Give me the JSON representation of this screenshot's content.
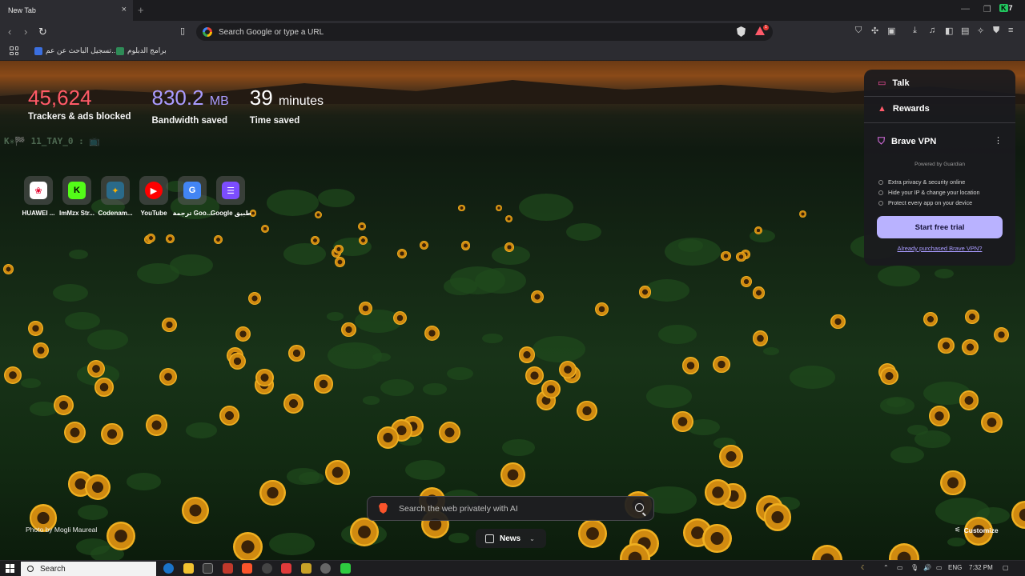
{
  "browser": {
    "tab_title": "New Tab",
    "tab_close": "×",
    "new_tab": "+",
    "window_controls": [
      "—",
      "❐",
      "✕"
    ],
    "omnibox_placeholder": "Search Google or type a URL",
    "rewards_count": "1",
    "k7_label": "7"
  },
  "bookmarks": [
    {
      "label": "تسجيل الباحث عن عم...",
      "color": "#3b6fe0"
    },
    {
      "label": "برامج الدبلوم",
      "color": "#2e8b57"
    }
  ],
  "stats": {
    "trackers": {
      "value": "45,624",
      "label": "Trackers & ads blocked"
    },
    "bandwidth": {
      "value": "830.2",
      "unit": "MB",
      "label": "Bandwidth saved"
    },
    "time": {
      "value": "39",
      "unit": "minutes",
      "label": "Time saved"
    }
  },
  "ticker": "K✳🏁 11_TAY_0 : 📺",
  "top_sites": [
    {
      "name": "HUAWEI ...",
      "bg": "#ffffff",
      "fg": "#e4002b",
      "glyph": "❀"
    },
    {
      "name": "ImMzx Str...",
      "bg": "#53fc18",
      "fg": "#000000",
      "glyph": "K"
    },
    {
      "name": "Codenam...",
      "bg": "#2a6a8a",
      "fg": "#ffb300",
      "glyph": "✦"
    },
    {
      "name": "YouTube",
      "bg": "#ff0000",
      "fg": "#ffffff",
      "glyph": "▶"
    },
    {
      "name": "ترجمة Goo...",
      "bg": "#4285f4",
      "fg": "#ffffff",
      "glyph": "G"
    },
    {
      "name": "Google تطبيق",
      "bg": "#7c4dff",
      "fg": "#ffffff",
      "glyph": "☰"
    }
  ],
  "panel": {
    "talk": "Talk",
    "rewards": "Rewards",
    "vpn_title": "Brave VPN",
    "kebab": "⋮",
    "powered_by": "Powered by  Guardian",
    "features": [
      "Extra privacy & security online",
      "Hide your IP & change your location",
      "Protect every app on your device"
    ],
    "cta": "Start free trial",
    "purchased": "Already purchased Brave VPN?"
  },
  "photo_credit": "Photo by Mogli Maureal",
  "search_placeholder": "Search the web privately with AI",
  "news_label": "News",
  "customize_label": "Customize",
  "taskbar": {
    "search_label": "Search",
    "lang": "ENG",
    "time": "7:32 PM"
  }
}
